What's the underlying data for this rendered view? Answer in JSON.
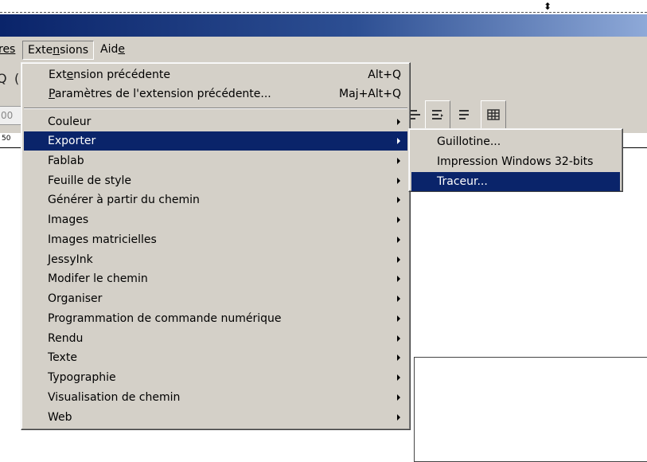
{
  "menubar": {
    "items": [
      {
        "label": "res",
        "pre": "",
        "ul": "",
        "post": "res"
      },
      {
        "label": "Extensions",
        "pre": "Exte",
        "ul": "n",
        "post": "sions"
      },
      {
        "label": "Aide",
        "pre": "Aid",
        "ul": "e",
        "post": ""
      }
    ]
  },
  "toolbar": {
    "spin_value": "00",
    "ruler_number": "50"
  },
  "extensions_menu": {
    "top_items": [
      {
        "label": "Extension précédente",
        "pre": "Ext",
        "ul": "e",
        "post": "nsion précédente",
        "shortcut": "Alt+Q"
      },
      {
        "label": "Paramètres de l'extension précédente...",
        "pre": "",
        "ul": "P",
        "post": "aramètres de l'extension précédente...",
        "shortcut": "Maj+Alt+Q"
      }
    ],
    "items": [
      "Couleur",
      "Exporter",
      "Fablab",
      "Feuille de style",
      "Générer à partir du chemin",
      "Images",
      "Images matricielles",
      "JessyInk",
      "Modifer le chemin",
      "Organiser",
      "Programmation de commande numérique",
      "Rendu",
      "Texte",
      "Typographie",
      "Visualisation de chemin",
      "Web"
    ],
    "selected": "Exporter"
  },
  "exporter_submenu": {
    "items": [
      "Guillotine...",
      "Impression Windows 32-bits",
      "Traceur..."
    ],
    "selected": "Traceur..."
  },
  "colors": {
    "selection": "#0a246a",
    "menu_bg": "#d4d0c8"
  }
}
